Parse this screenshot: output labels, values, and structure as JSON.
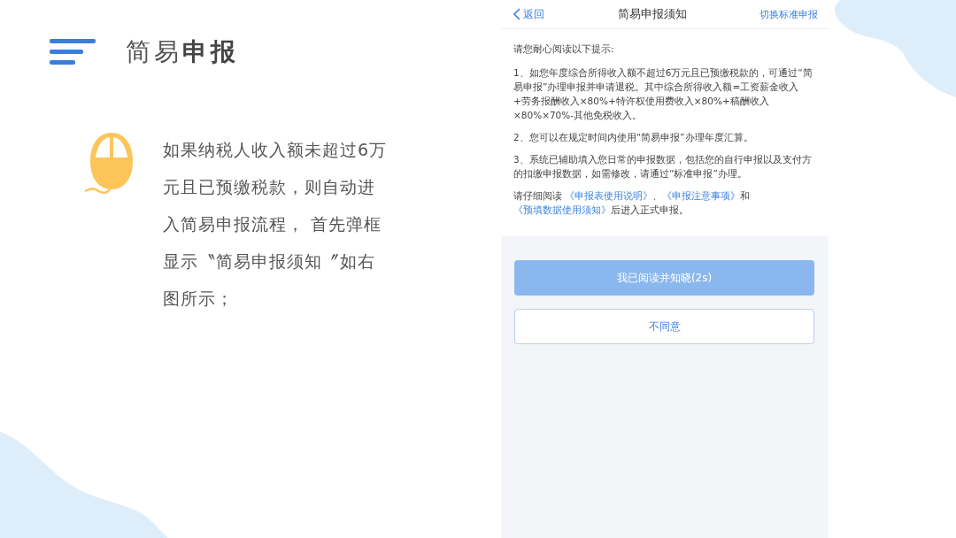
{
  "slide": {
    "title": "简易**申报**",
    "description": "如果纳税人收入额未超过6万元且已预缴税款，则自动进入简易申报流程， 首先弹框显示〝简易申报须知〞如右图所示；"
  },
  "phone": {
    "nav": {
      "back": "返回",
      "title": "简易申报须知",
      "action": "切换标准申报"
    },
    "intro": "请您耐心阅读以下提示:",
    "items": [
      "1、如您年度综合所得收入额不超过6万元且已预缴税款的，可通过“简易申报”办理申报并申请退税。其中综合所得收入额=工资薪金收入+劳务报酬收入×80%+特许权使用费收入×80%+稿酬收入×80%×70%-其他免税收入。",
      "2、您可以在规定时间内使用“简易申报”办理年度汇算。",
      "3、系统已辅助填入您日常的申报数据，包括您的自行申报以及支付方的扣缴申报数据，如需修改，请通过“标准申报”办理。"
    ],
    "closing": [
      {
        "text": "请仔细阅读 ",
        "kind": "text"
      },
      {
        "text": "《申报表使用说明》",
        "kind": "link"
      },
      {
        "text": "、",
        "kind": "text"
      },
      {
        "text": "《申报注意事项》",
        "kind": "link"
      },
      {
        "text": "和",
        "kind": "text"
      },
      {
        "text": "《预填数据使用须知》",
        "kind": "link"
      },
      {
        "text": "后进入正式申报。",
        "kind": "text"
      }
    ],
    "buttons": [
      {
        "label": "我已阅读并知晓(2s)",
        "kind": "primary",
        "disabled": true
      },
      {
        "label": "不同意",
        "kind": "outline",
        "disabled": false
      }
    ]
  }
}
